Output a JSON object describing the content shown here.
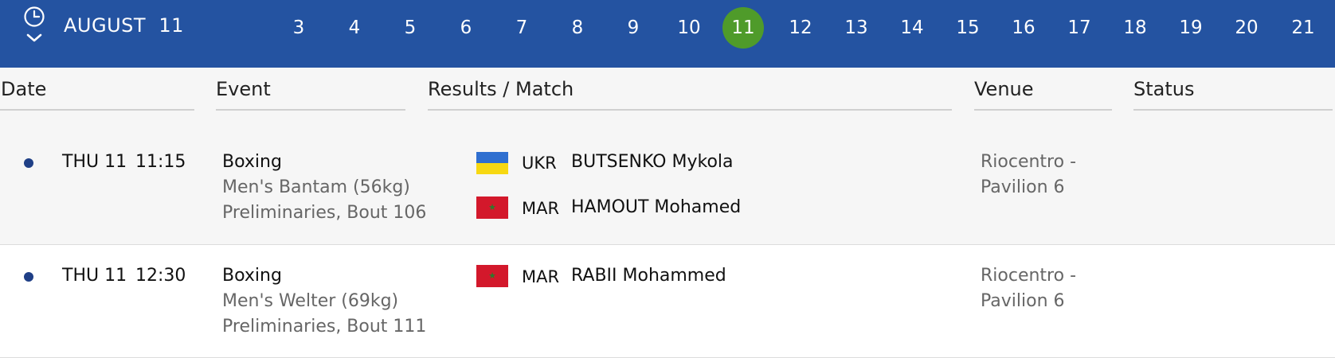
{
  "header": {
    "month": "AUGUST",
    "day": "11",
    "days": [
      "3",
      "4",
      "5",
      "6",
      "7",
      "8",
      "9",
      "10",
      "11",
      "12",
      "13",
      "14",
      "15",
      "16",
      "17",
      "18",
      "19",
      "20",
      "21"
    ],
    "active_day": "11",
    "clock_icon": "clock-icon",
    "chevron_icon": "chevron-down-icon",
    "accent_color": "#2453a1",
    "active_color": "#4f9b2a"
  },
  "columns": {
    "date": "Date",
    "event": "Event",
    "results": "Results / Match",
    "venue": "Venue",
    "status": "Status"
  },
  "rows": [
    {
      "date": "THU 11",
      "time": "11:15",
      "sport": "Boxing",
      "event": "Men's Bantam (56kg)",
      "phase": "Preliminaries, Bout 106",
      "competitors": [
        {
          "country": "UKR",
          "name": "BUTSENKO Mykola",
          "flag": "ukraine-flag"
        },
        {
          "country": "MAR",
          "name": "HAMOUT Mohamed",
          "flag": "morocco-flag"
        }
      ],
      "venue_line1": "Riocentro -",
      "venue_line2": "Pavilion 6",
      "status": ""
    },
    {
      "date": "THU 11",
      "time": "12:30",
      "sport": "Boxing",
      "event": "Men's Welter (69kg)",
      "phase": "Preliminaries, Bout 111",
      "competitors": [
        {
          "country": "MAR",
          "name": "RABII Mohammed",
          "flag": "morocco-flag"
        }
      ],
      "venue_line1": "Riocentro -",
      "venue_line2": "Pavilion 6",
      "status": ""
    }
  ]
}
